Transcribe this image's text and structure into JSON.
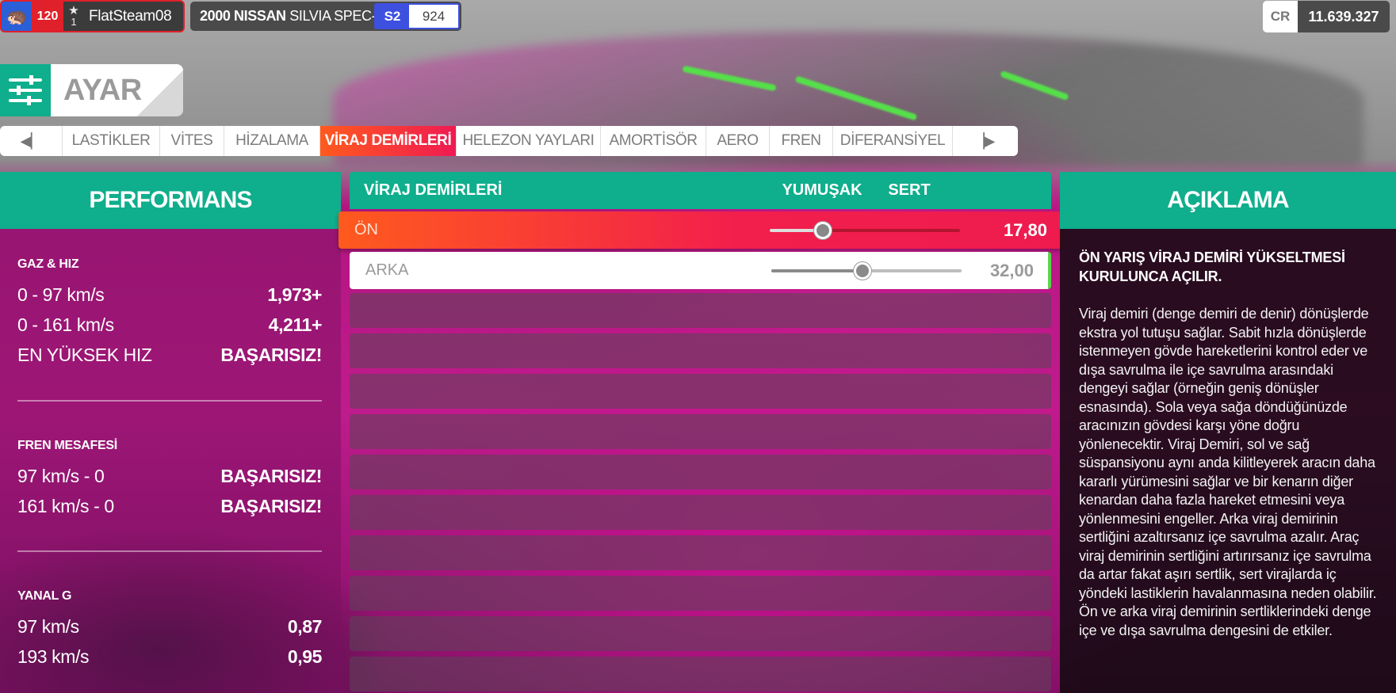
{
  "player": {
    "level": "120",
    "rank": "1",
    "gamertag": "FlatSteam08"
  },
  "car": {
    "year_make": "2000 NISSAN",
    "model": "SILVIA SPEC-R",
    "class": "S2",
    "pi": "924"
  },
  "credits": {
    "label": "CR",
    "value": "11.639.327"
  },
  "header": {
    "title": "AYAR"
  },
  "tabs": {
    "items": [
      {
        "label": "LASTİKLER"
      },
      {
        "label": "VİTES"
      },
      {
        "label": "HİZALAMA"
      },
      {
        "label": "VİRAJ DEMİRLERİ"
      },
      {
        "label": "HELEZON YAYLARI"
      },
      {
        "label": "AMORTİSÖR"
      },
      {
        "label": "AERO"
      },
      {
        "label": "FREN"
      },
      {
        "label": "DİFERANSİYEL"
      }
    ],
    "active": "VİRAJ DEMİRLERİ"
  },
  "performance": {
    "title": "PERFORMANS",
    "sections": [
      {
        "title": "GAZ & HIZ",
        "rows": [
          {
            "label": "0 - 97 km/s",
            "value": "1,973+"
          },
          {
            "label": "0 - 161 km/s",
            "value": "4,211+"
          },
          {
            "label": "EN YÜKSEK HIZ",
            "value": "BAŞARISIZ!"
          }
        ]
      },
      {
        "title": "FREN MESAFESİ",
        "rows": [
          {
            "label": "97 km/s - 0",
            "value": "BAŞARISIZ!"
          },
          {
            "label": "161 km/s - 0",
            "value": "BAŞARISIZ!"
          }
        ]
      },
      {
        "title": "YANAL G",
        "rows": [
          {
            "label": "97 km/s",
            "value": "0,87"
          },
          {
            "label": "193 km/s",
            "value": "0,95"
          }
        ]
      }
    ]
  },
  "settings": {
    "header": {
      "title": "VİRAJ DEMİRLERİ",
      "soft": "YUMUŞAK",
      "hard": "SERT"
    },
    "rows": [
      {
        "label": "ÖN",
        "value": "17,80",
        "fraction": 0.28
      },
      {
        "label": "ARKA",
        "value": "32,00",
        "fraction": 0.48
      }
    ]
  },
  "description": {
    "title": "AÇIKLAMA",
    "heading": "ÖN YARIŞ VİRAJ DEMİRİ YÜKSELTMESİ KURULUNCA AÇILIR.",
    "body": "Viraj demiri (denge demiri de denir) dönüşlerde ekstra yol tutuşu sağlar. Sabit hızla dönüşlerde istenmeyen gövde hareketlerini kontrol eder ve dışa savrulma ile içe savrulma arasındaki dengeyi sağlar (örneğin geniş dönüşler esnasında). Sola veya sağa döndüğünüzde aracınızın gövdesi karşı yöne doğru yönlenecektir. Viraj Demiri, sol ve sağ süspansiyonu aynı anda kilitleyerek aracın daha kararlı yürümesini sağlar ve bir kenarın diğer kenardan daha fazla hareket etmesini veya yönlenmesini engeller. Arka viraj demirinin sertliğini azaltırsanız içe savrulma azalır. Araç viraj demirinin sertliğini artırırsanız içe savrulma da artar fakat aşırı sertlik, sert virajlarda iç yöndeki lastiklerin havalanmasına neden olabilir. Ön ve arka viraj demirinin sertliklerindeki denge içe ve dışa savrulma dengesini de etkiler."
  },
  "colors": {
    "accent": "#0fae8c",
    "active": "#f21f4c",
    "class": "#3d50e0"
  }
}
